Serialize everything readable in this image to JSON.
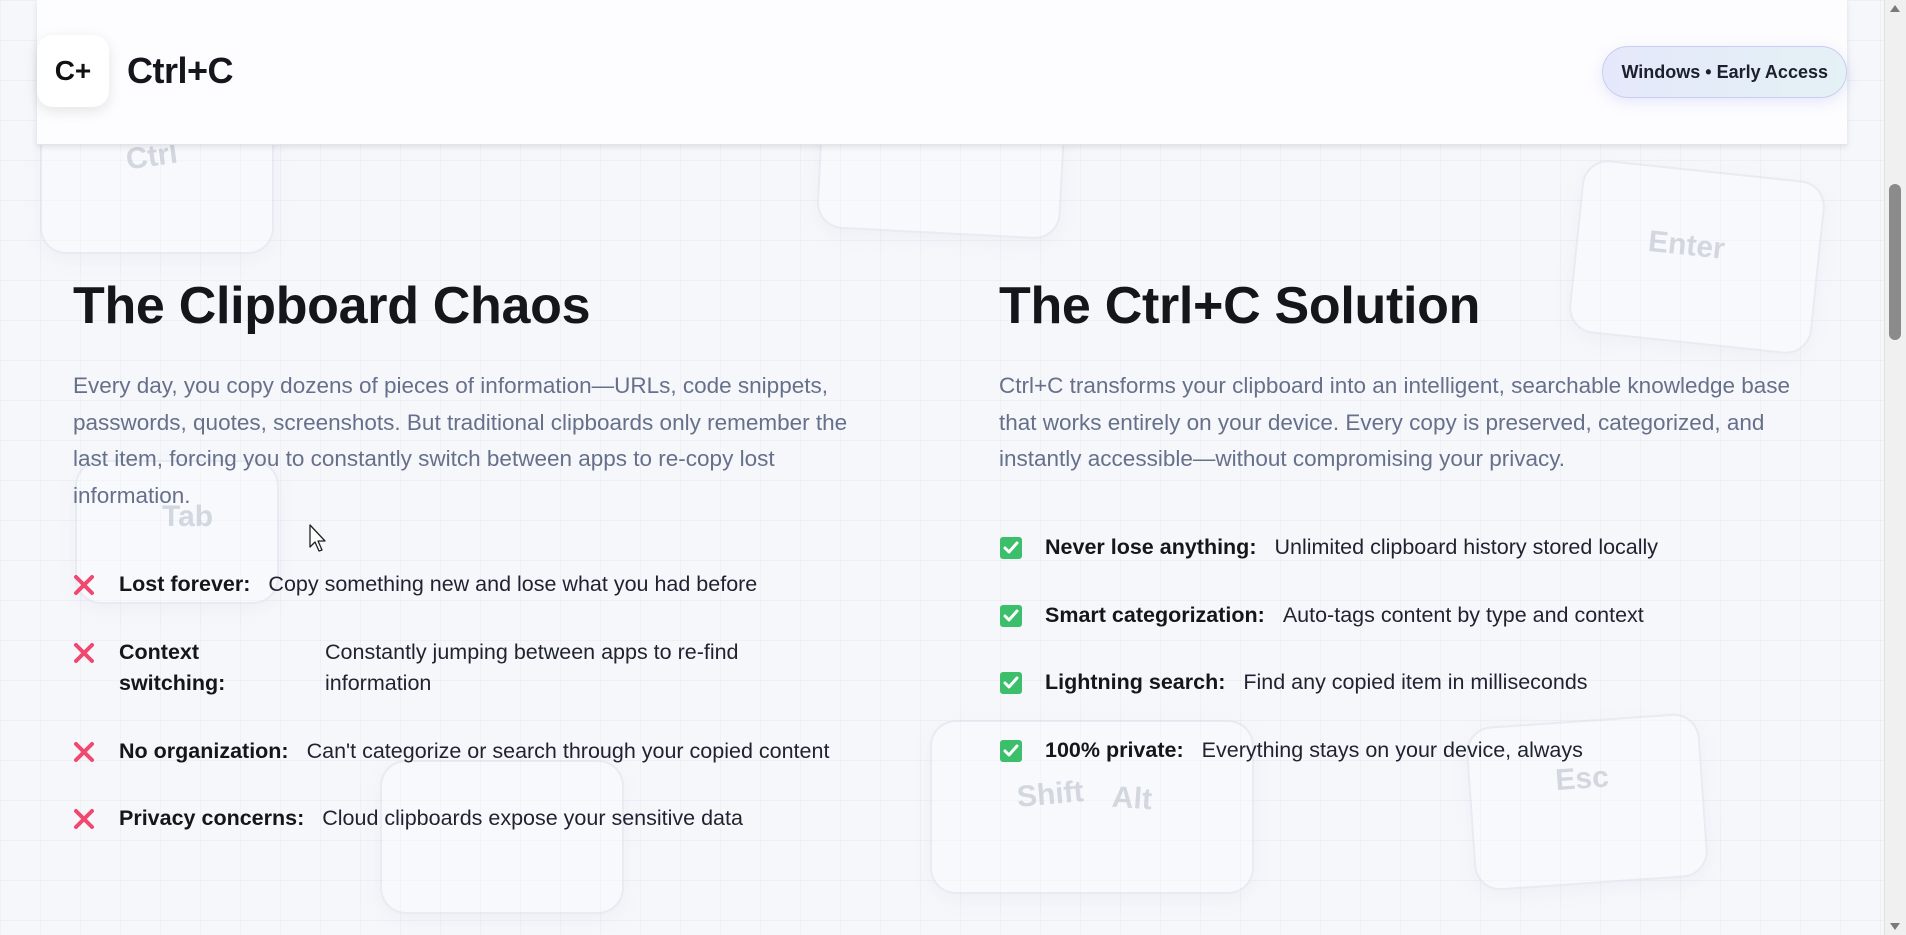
{
  "header": {
    "logo_text": "C+",
    "brand_name": "Ctrl+C",
    "badge": "Windows • Early Access"
  },
  "background_keys": {
    "ctrl": "Ctrl",
    "enter": "Enter",
    "tab": "Tab",
    "shift": "Shift",
    "alt": "Alt",
    "esc": "Esc"
  },
  "problem": {
    "title": "The Clipboard Chaos",
    "description": "Every day, you copy dozens of pieces of information—URLs, code snippets, passwords, quotes, screenshots. But traditional clipboards only remember the last item, forcing you to constantly switch between apps to re-copy lost information.",
    "items": [
      {
        "label": "Lost forever:",
        "text": "Copy something new and lose what you had before"
      },
      {
        "label": "Context switching:",
        "text": "Constantly jumping between apps to re-find information"
      },
      {
        "label": "No organization:",
        "text": "Can't categorize or search through your copied content"
      },
      {
        "label": "Privacy concerns:",
        "text": "Cloud clipboards expose your sensitive data"
      }
    ]
  },
  "solution": {
    "title": "The Ctrl+C Solution",
    "description": "Ctrl+C transforms your clipboard into an intelligent, searchable knowledge base that works entirely on your device. Every copy is preserved, categorized, and instantly accessible—without compromising your privacy.",
    "items": [
      {
        "label": "Never lose anything:",
        "text": "Unlimited clipboard history stored locally"
      },
      {
        "label": "Smart categorization:",
        "text": "Auto-tags content by type and context"
      },
      {
        "label": "Lightning search:",
        "text": "Find any copied item in milliseconds"
      },
      {
        "label": "100% private:",
        "text": "Everything stays on your device, always"
      }
    ]
  },
  "colors": {
    "x_mark": "#f0486e",
    "check_mark": "#3bbf6a",
    "badge_border": "#c9cdf0"
  },
  "icons": {
    "problem_marker": "x-icon",
    "solution_marker": "checkbox-check-icon"
  }
}
